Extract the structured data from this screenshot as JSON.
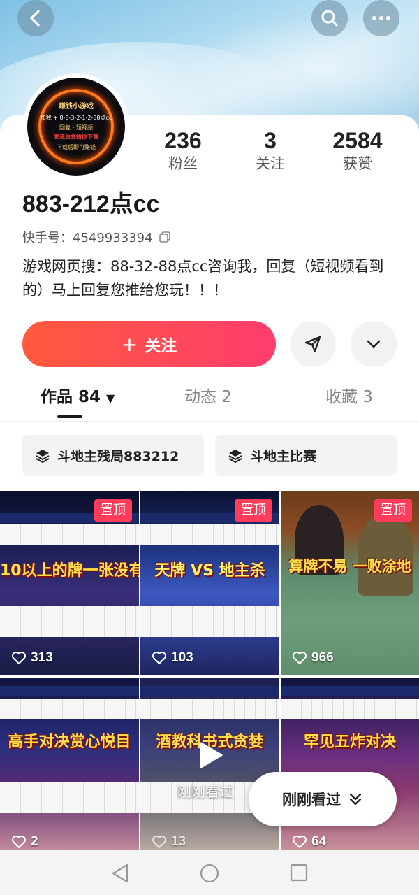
{
  "header": {
    "back_icon": "chevron-left-icon",
    "search_icon": "search-icon",
    "more_icon": "more-dots-icon"
  },
  "profile": {
    "avatar_text": [
      "赚钱小游戏",
      "加我 + 8-8-3-2-1-2-88点cc",
      "回复 - 短视频",
      "发送后会给你下载",
      "下载后即可赚钱"
    ],
    "stats": [
      {
        "value": "236",
        "label": "粉丝"
      },
      {
        "value": "3",
        "label": "关注"
      },
      {
        "value": "2584",
        "label": "获赞"
      }
    ],
    "username": "883-212点cc",
    "kuaishou_id": "快手号：4549933394",
    "bio": "游戏网页搜：88-32-88点cc咨询我，回复（短视频看到的）马上回复您推给您玩！！！"
  },
  "actions": {
    "follow_label": "关注",
    "follow_color": "#ff4a5a",
    "share_icon": "send-icon",
    "expand_icon": "chevron-down-icon"
  },
  "tabs": [
    {
      "label": "作品 84"
    },
    {
      "label": "动态 2"
    },
    {
      "label": "收藏 3"
    }
  ],
  "collections": [
    {
      "label": "斗地主残局883212",
      "icon": "layers-icon"
    },
    {
      "label": "斗地主比赛",
      "icon": "layers-icon"
    }
  ],
  "videos": [
    {
      "caption": "10以上的牌一张没有",
      "likes": "313",
      "pinned": true,
      "pin_label": "置顶"
    },
    {
      "caption": "天牌 VS 地主杀",
      "likes": "103",
      "pinned": true,
      "pin_label": "置顶"
    },
    {
      "caption": "算牌不易 一败涂地",
      "likes": "966",
      "pinned": true,
      "pin_label": "置顶"
    },
    {
      "caption": "高手对决赏心悦目",
      "likes": "2",
      "pinned": false
    },
    {
      "caption": "酒教科书式贪婪",
      "likes": "13",
      "pinned": false
    },
    {
      "caption": "罕见五炸对决",
      "likes": "64",
      "pinned": false
    }
  ],
  "overlay": {
    "just_watched_caption": "刚刚看过",
    "just_watched_button": "刚刚看过"
  },
  "navbar": {
    "back_icon": "nav-back-triangle-icon",
    "home_icon": "nav-home-circle-icon",
    "recent_icon": "nav-recent-square-icon"
  }
}
